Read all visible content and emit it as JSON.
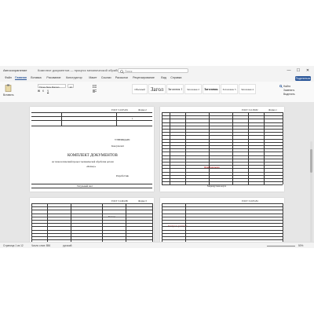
{
  "titlebar": {
    "autosave_label": "Автосохранение",
    "file_name": "Комплект документов — процесс механической обработки — Сохранено",
    "search_placeholder": "Поиск",
    "minimize": "—",
    "maximize": "☐",
    "close": "✕"
  },
  "tabs": [
    "Файл",
    "Главная",
    "Вставка",
    "Рисование",
    "Конструктор",
    "Макет",
    "Ссылки",
    "Рассылки",
    "Рецензирование",
    "Вид",
    "Справка"
  ],
  "share_label": "Поделиться",
  "ribbon": {
    "paste_label": "Вставить",
    "font_name": "Times New Roman",
    "font_size": "12",
    "styles": [
      "Обычный",
      "Загол",
      "Заголовок 1",
      "Заголовок 2",
      "Заголовок",
      "Заголовок 3",
      "Заголовок 4"
    ],
    "find_label": "Найти",
    "replace_label": "Заменить",
    "select_label": "Выделить"
  },
  "page1": {
    "top_label": "ГОСТ 3.1105-84",
    "form_label": "Форма 2",
    "sheet_label": "1",
    "approve_label": "УТВЕРЖДАЮ",
    "approver": "Консультант",
    "title": "КОМПЛЕКТ ДОКУМЕНТОВ",
    "subtitle": "на технологический процесс механической обработки детали",
    "detail_name": "«Кольцо»",
    "developer_label": "Разработчик",
    "footer_label": "Титульный лист"
  },
  "page2": {
    "top_label": "ГОСТ 3.1118-82",
    "form_label": "Форма 1",
    "footer_label": "Маршрутная карта"
  },
  "page3": {
    "top_label": "ГОСТ 3.1404-86",
    "form_label": "Форма 3",
    "detail_label": "Кольцо",
    "footer_label": "Операционная карта"
  },
  "page4": {
    "top_label": "ГОСТ 3.1105-84",
    "red_line": "Контроль размеров",
    "footer_label": "Карта эскизов"
  },
  "statusbar": {
    "page_info": "Страница 1 из 12",
    "words": "Число слов: 856",
    "lang": "русский",
    "zoom": "50%"
  }
}
